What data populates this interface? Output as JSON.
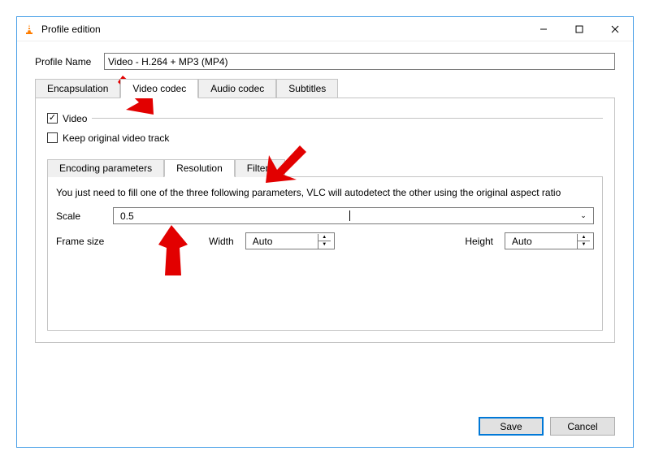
{
  "window": {
    "title": "Profile edition"
  },
  "profile": {
    "label": "Profile Name",
    "value": "Video - H.264 + MP3 (MP4)"
  },
  "tabs": {
    "encapsulation": "Encapsulation",
    "video_codec": "Video codec",
    "audio_codec": "Audio codec",
    "subtitles": "Subtitles"
  },
  "video_group": {
    "video_label": "Video",
    "keep_original": "Keep original video track"
  },
  "inner_tabs": {
    "encoding": "Encoding parameters",
    "resolution": "Resolution",
    "filters": "Filters"
  },
  "resolution_panel": {
    "hint": "You just need to fill one of the three following parameters, VLC will autodetect the other using the original aspect ratio",
    "scale_label": "Scale",
    "scale_value": "0.5",
    "framesize_label": "Frame size",
    "width_label": "Width",
    "width_value": "Auto",
    "height_label": "Height",
    "height_value": "Auto"
  },
  "buttons": {
    "save": "Save",
    "cancel": "Cancel"
  }
}
